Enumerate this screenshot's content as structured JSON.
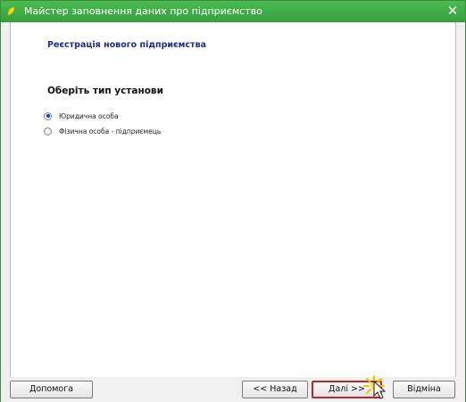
{
  "window": {
    "title": "Майстер заповнення даних про підприємство",
    "close_glyph": "✕",
    "accent_color": "#3aa843"
  },
  "page": {
    "header": "Реєстрація нового підприємства",
    "section_title": "Оберіть тип установи",
    "options": [
      {
        "label": "Юридична особа",
        "selected": true
      },
      {
        "label": "Фізична особа - підприємець",
        "selected": false
      }
    ]
  },
  "buttons": {
    "help": "Допомога",
    "back": "<< Назад",
    "next": "Далі >>",
    "cancel": "Відміна"
  },
  "icons": {
    "title": "app-leaf-icon",
    "cursor": "pointer-cursor-icon",
    "click": "click-burst-icon"
  }
}
